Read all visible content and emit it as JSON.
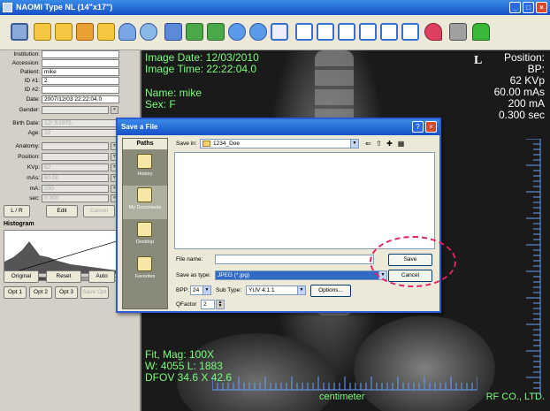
{
  "window": {
    "title": "NAOMI  Type NL  (14\"x17\")",
    "controls": {
      "minimize": "_",
      "maximize": "□",
      "close": "×"
    }
  },
  "toolbar": {
    "icons": [
      "home-icon",
      "folder-open-icon",
      "folder-add-icon",
      "folder-box-icon",
      "folder-export-icon",
      "drive-icon",
      "globe-icon",
      "edit-image-icon",
      "zoom-icon",
      "flip-icon",
      "rotate-icon",
      "undo-icon",
      "text-tool-icon",
      "layout-1-icon",
      "layout-2-icon",
      "layout-3-icon",
      "layout-4-icon",
      "layout-5-icon",
      "layout-6-icon",
      "heart-icon",
      "tools-icon",
      "lock-icon"
    ]
  },
  "patient_panel": {
    "fields": [
      {
        "label": "Institution:",
        "value": "",
        "disabled": false
      },
      {
        "label": "Accession:",
        "value": "",
        "disabled": false
      },
      {
        "label": "Patient:",
        "value": "mike",
        "disabled": false
      },
      {
        "label": "ID #1:",
        "value": "2",
        "disabled": false
      },
      {
        "label": "ID #2:",
        "value": "",
        "disabled": false
      },
      {
        "label": "Date:",
        "value": "2007/12/03 22:22:04.0",
        "disabled": false
      },
      {
        "label": "Gender:",
        "value": "",
        "disabled": true
      },
      {
        "label": "Birth Date:",
        "value": "12/ 3/1975",
        "disabled": true
      },
      {
        "label": "Age:",
        "value": "32",
        "disabled": true
      },
      {
        "label": "Anatomy:",
        "value": "",
        "disabled": true
      },
      {
        "label": "Position:",
        "value": "",
        "disabled": true
      },
      {
        "label": "KVp:",
        "value": "62",
        "disabled": true
      },
      {
        "label": "mAs:",
        "value": "60.00",
        "disabled": true
      },
      {
        "label": "mA:",
        "value": "200",
        "disabled": true
      },
      {
        "label": "sec:",
        "value": "0.300",
        "disabled": true
      }
    ],
    "lr_button": "L / R",
    "edit_button": "Edit",
    "cancel_button": "Cancel",
    "histogram_label": "Histogram",
    "mode_buttons": [
      "Original",
      "Reset",
      "Auto"
    ],
    "opt_buttons": [
      "Opt 1",
      "Opt 2",
      "Opt 3",
      "Save Opt"
    ]
  },
  "viewer": {
    "top_left": [
      "Image Date: 12/03/2010",
      "Image Time: 22:22:04.0",
      "",
      "Name: mike",
      "Sex: F"
    ],
    "marker": "L",
    "top_right": [
      "Position:",
      "BP:",
      "62 KVp",
      "60.00 mAs",
      "200 mA",
      "0.300 sec"
    ],
    "bottom_left": [
      "Fit, Mag: 100X",
      "W: 4055 L: 1883",
      "DFOV 34.6 X 42.6"
    ],
    "ruler_label": "centimeter",
    "company": "RF CO., LTD."
  },
  "save_dialog": {
    "title": "Save a File",
    "help": "?",
    "close": "×",
    "places_header": "Paths",
    "places": [
      "History",
      "My Documents",
      "Desktop",
      "Favorites"
    ],
    "save_in_label": "Save in:",
    "save_in_value": "1234_Doe",
    "file_name_label": "File name:",
    "file_name_value": "",
    "save_as_type_label": "Save as type:",
    "save_as_type_value": "JPEG (*.jpg)",
    "save_button": "Save",
    "cancel_button": "Cancel",
    "bpp_label": "BPP:",
    "bpp_value": "24",
    "subtype_label": "Sub Type:",
    "subtype_value": "YUV 4:1:1",
    "options_button": "Options...",
    "qfactor_label": "QFactor",
    "qfactor_value": "2"
  },
  "colors": {
    "highlight": "#e0206a",
    "overlay_green": "#7cfc7c",
    "titlebar": "#1550c8"
  }
}
